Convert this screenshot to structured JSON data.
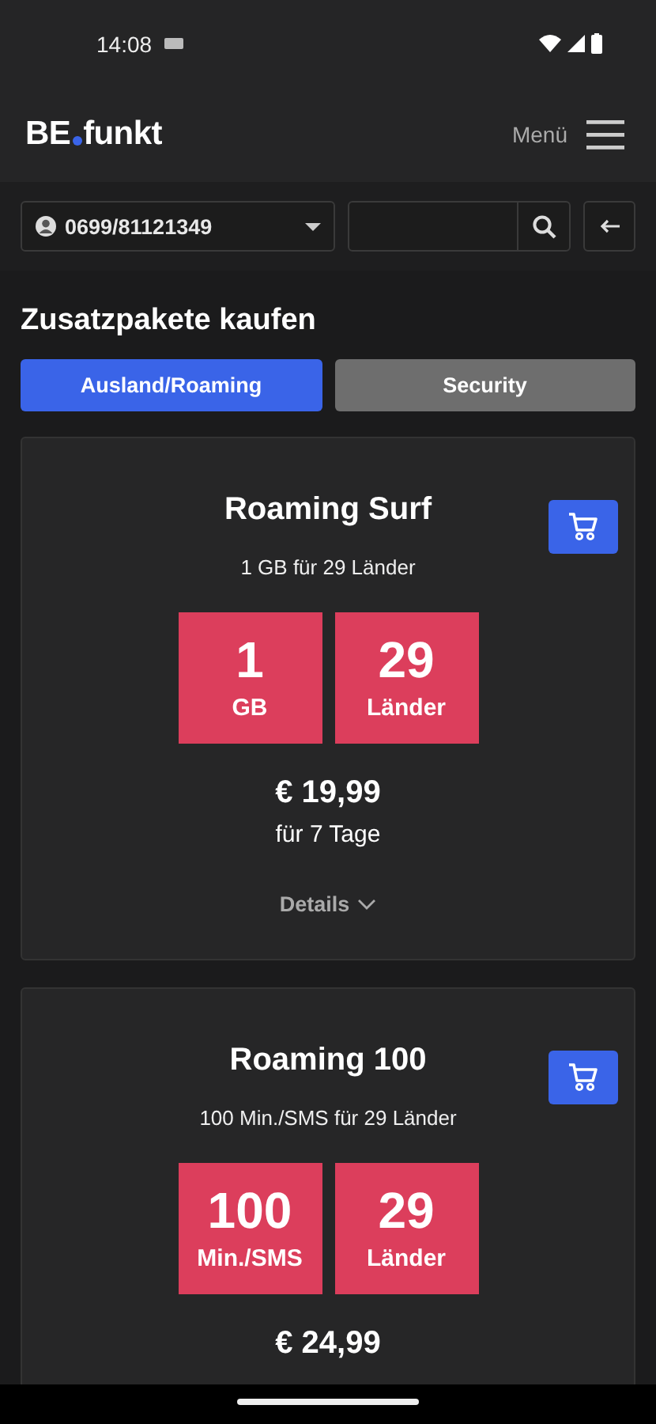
{
  "status_bar": {
    "time": "14:08"
  },
  "header": {
    "logo_left": "BE",
    "logo_right": "funkt",
    "menu_label": "Menü"
  },
  "toolbar": {
    "phone_number": "0699/81121349"
  },
  "page_title": "Zusatzpakete kaufen",
  "tabs": [
    {
      "label": "Ausland/Roaming",
      "selected": true
    },
    {
      "label": "Security",
      "selected": false
    }
  ],
  "packages": [
    {
      "title": "Roaming Surf",
      "subtitle": "1 GB für 29 Länder",
      "tiles": [
        {
          "value": "1",
          "unit": "GB"
        },
        {
          "value": "29",
          "unit": "Länder"
        }
      ],
      "price": "€ 19,99",
      "period": "für 7 Tage",
      "details": "Details"
    },
    {
      "title": "Roaming 100",
      "subtitle": "100 Min./SMS für 29 Länder",
      "tiles": [
        {
          "value": "100",
          "unit": "Min./SMS"
        },
        {
          "value": "29",
          "unit": "Länder"
        }
      ],
      "price": "€ 24,99"
    }
  ]
}
